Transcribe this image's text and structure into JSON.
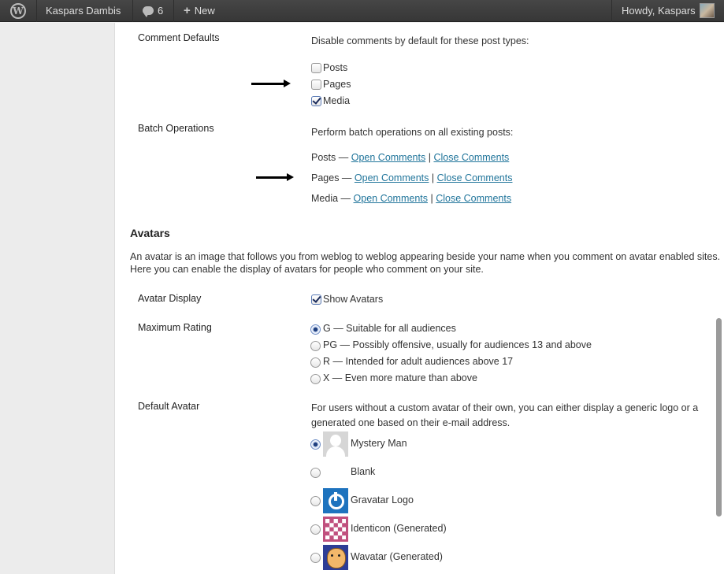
{
  "adminbar": {
    "site_name": "Kaspars Dambis",
    "comments_count": "6",
    "new_label": "New",
    "howdy": "Howdy, Kaspars"
  },
  "comment_defaults": {
    "label": "Comment Defaults",
    "description": "Disable comments by default for these post types:",
    "options": [
      {
        "label": "Posts",
        "checked": false
      },
      {
        "label": "Pages",
        "checked": false
      },
      {
        "label": "Media",
        "checked": true
      }
    ]
  },
  "batch_operations": {
    "label": "Batch Operations",
    "description": "Perform batch operations on all existing posts:",
    "rows": [
      {
        "type": "Posts —",
        "open": "Open Comments",
        "sep": "|",
        "close": "Close Comments"
      },
      {
        "type": "Pages —",
        "open": "Open Comments",
        "sep": "|",
        "close": "Close Comments"
      },
      {
        "type": "Media —",
        "open": "Open Comments",
        "sep": "|",
        "close": "Close Comments"
      }
    ]
  },
  "avatars": {
    "heading": "Avatars",
    "intro_line1": "An avatar is an image that follows you from weblog to weblog appearing beside your name when you comment on avatar enabled sites.",
    "intro_line2": "Here you can enable the display of avatars for people who comment on your site.",
    "display_label": "Avatar Display",
    "show_avatars": "Show Avatars",
    "show_avatars_checked": true,
    "rating_label": "Maximum Rating",
    "ratings": [
      {
        "label": "G — Suitable for all audiences",
        "selected": true
      },
      {
        "label": "PG — Possibly offensive, usually for audiences 13 and above",
        "selected": false
      },
      {
        "label": "R — Intended for adult audiences above 17",
        "selected": false
      },
      {
        "label": "X — Even more mature than above",
        "selected": false
      }
    ],
    "default_label": "Default Avatar",
    "default_desc_line1": "For users without a custom avatar of their own, you can either display a generic logo or a",
    "default_desc_line2": "generated one based on their e-mail address.",
    "defaults": [
      {
        "label": "Mystery Man",
        "icon": "mystery-man-icon",
        "selected": true
      },
      {
        "label": "Blank",
        "icon": "blank-avatar",
        "selected": false
      },
      {
        "label": "Gravatar Logo",
        "icon": "gravatar-logo-icon",
        "selected": false
      },
      {
        "label": "Identicon (Generated)",
        "icon": "identicon-icon",
        "selected": false
      },
      {
        "label": "Wavatar (Generated)",
        "icon": "wavatar-icon",
        "selected": false
      }
    ]
  }
}
